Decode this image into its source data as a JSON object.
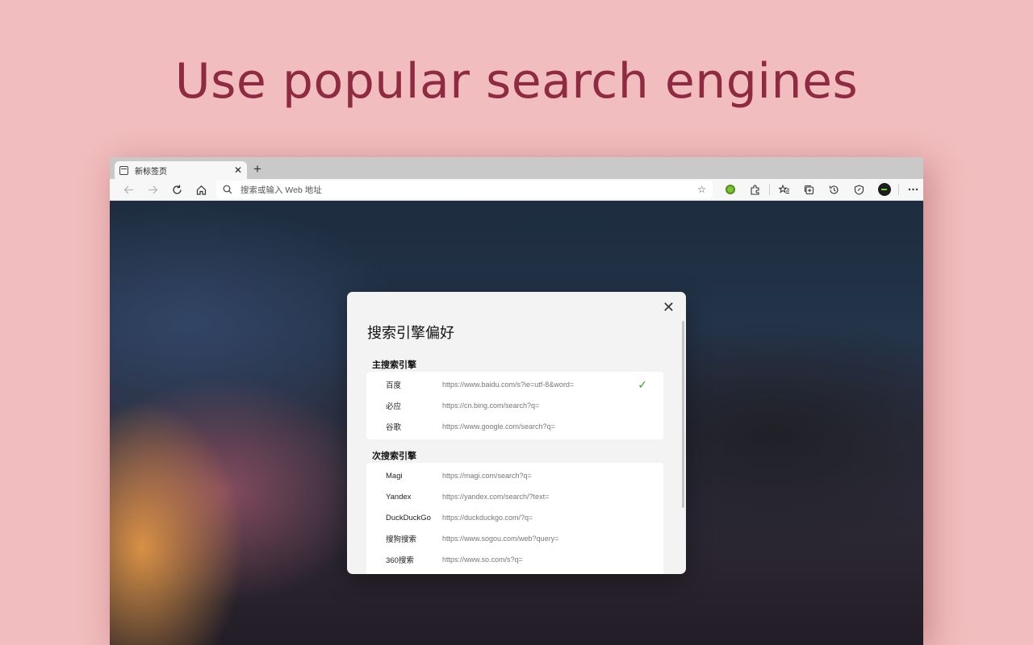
{
  "headline": "Use popular search engines",
  "browser": {
    "tab_title": "新标签页",
    "tab_close": "✕",
    "new_tab": "+",
    "address_placeholder": "搜索或输入 Web 地址",
    "accent_color": "#7cc232"
  },
  "dialog": {
    "close": "✕",
    "title": "搜索引擎偏好",
    "primary_section": "主搜索引擎",
    "secondary_section": "次搜索引擎",
    "primary_engines": [
      {
        "name": "百度",
        "url": "https://www.baidu.com/s?ie=utf-8&word=",
        "selected": true
      },
      {
        "name": "必应",
        "url": "https://cn.bing.com/search?q=",
        "selected": false
      },
      {
        "name": "谷歌",
        "url": "https://www.google.com/search?q=",
        "selected": false
      }
    ],
    "secondary_engines": [
      {
        "name": "Magi",
        "url": "https://magi.com/search?q="
      },
      {
        "name": "Yandex",
        "url": "https://yandex.com/search/?text="
      },
      {
        "name": "DuckDuckGo",
        "url": "https://duckduckgo.com/?q="
      },
      {
        "name": "搜狗搜索",
        "url": "https://www.sogou.com/web?query="
      },
      {
        "name": "360搜索",
        "url": "https://www.so.com/s?q="
      }
    ],
    "check_glyph": "✓"
  }
}
